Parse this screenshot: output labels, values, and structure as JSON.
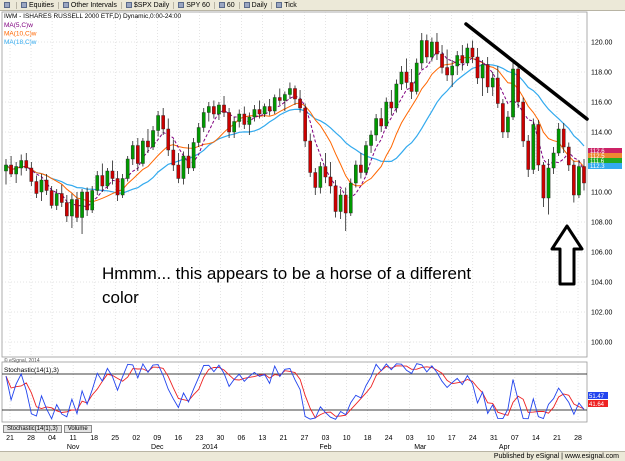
{
  "toolbar": {
    "items": [
      {
        "label": "",
        "icon": "grid-icon"
      },
      {
        "label": "Equities",
        "icon": "dropdown-icon"
      },
      {
        "label": "Other Intervals",
        "icon": "dropdown-icon"
      },
      {
        "label": "$SPX Daily",
        "icon": "chart-icon"
      },
      {
        "label": "SPY 60",
        "icon": "chart-icon"
      },
      {
        "label": "60",
        "icon": "chart-icon"
      },
      {
        "label": "Daily",
        "icon": "chart-icon"
      },
      {
        "label": "Tick",
        "icon": "chart-icon"
      }
    ]
  },
  "header": {
    "title": "IWM - ISHARES RUSSELL 2000 ETF,D) Dynamic,0:00-24:00",
    "ma_labels": [
      "MA(5,C)w",
      "MA(10,C)w",
      "MA(18,C)w"
    ]
  },
  "annotation": {
    "line1": "Hmmm... this appears to be a horse of a different",
    "line2": "color"
  },
  "stochastic_label": "Stochastic(14(1),3)",
  "tabs": [
    "Stochastic(14(1),3)",
    "Volume"
  ],
  "footer": "Published by eSignal | www.esignal.com",
  "copyright": "© eSignal, 2014",
  "colors": {
    "up": "#009900",
    "down": "#cc0000",
    "ma5": "#800080",
    "ma10": "#ff6600",
    "ma18": "#33aaee",
    "stoch_k": "#2244ee",
    "stoch_d": "#ee2222",
    "grid": "#c8c8c8",
    "price_labels": [
      "#cc2266",
      "#ee8833",
      "#22aa22",
      "#33aaee"
    ],
    "stoch_labels": [
      "#2244ee",
      "#ee2222"
    ]
  },
  "chart_data": {
    "type": "candlestick",
    "title": "IWM - ISHARES RUSSELL 2000 ETF,D) Dynamic,0:00-24:00",
    "ylim": [
      99,
      122
    ],
    "y_ticks": [
      "120.00",
      "118.00",
      "116.00",
      "114.00",
      "112.00",
      "110.00",
      "108.00",
      "106.00",
      "104.00",
      "102.00",
      "100.00"
    ],
    "current_price_labels": [
      "112.6",
      "112.5",
      "111.6",
      "112.3"
    ],
    "x_tick_labels": [
      "21",
      "28",
      "04",
      "11",
      "18",
      "25",
      "02",
      "09",
      "16",
      "23",
      "30",
      "06",
      "13",
      "21",
      "27",
      "03",
      "10",
      "18",
      "24",
      "03",
      "10",
      "17",
      "24",
      "31",
      "07",
      "14",
      "21",
      "28"
    ],
    "month_labels": [
      "Nov",
      "Dec",
      "2014",
      "Feb",
      "Mar",
      "Apr"
    ],
    "grid": true,
    "candles": [
      {
        "o": 111.4,
        "h": 112.2,
        "l": 110.5,
        "c": 111.8
      },
      {
        "o": 111.8,
        "h": 112.4,
        "l": 111.0,
        "c": 111.2
      },
      {
        "o": 111.2,
        "h": 112.0,
        "l": 110.6,
        "c": 111.7
      },
      {
        "o": 111.6,
        "h": 112.5,
        "l": 111.1,
        "c": 112.1
      },
      {
        "o": 112.1,
        "h": 112.6,
        "l": 111.4,
        "c": 111.6
      },
      {
        "o": 111.6,
        "h": 112.0,
        "l": 110.4,
        "c": 110.7
      },
      {
        "o": 110.7,
        "h": 111.1,
        "l": 109.6,
        "c": 109.9
      },
      {
        "o": 110.0,
        "h": 111.2,
        "l": 109.4,
        "c": 110.8
      },
      {
        "o": 110.8,
        "h": 111.2,
        "l": 109.8,
        "c": 110.1
      },
      {
        "o": 110.1,
        "h": 110.4,
        "l": 108.9,
        "c": 109.1
      },
      {
        "o": 109.1,
        "h": 110.2,
        "l": 108.8,
        "c": 109.9
      },
      {
        "o": 109.9,
        "h": 110.5,
        "l": 109.0,
        "c": 109.3
      },
      {
        "o": 109.3,
        "h": 109.8,
        "l": 108.0,
        "c": 108.4
      },
      {
        "o": 108.4,
        "h": 109.9,
        "l": 107.6,
        "c": 109.5
      },
      {
        "o": 109.5,
        "h": 110.0,
        "l": 108.0,
        "c": 108.3
      },
      {
        "o": 108.3,
        "h": 110.2,
        "l": 107.2,
        "c": 110.0
      },
      {
        "o": 110.0,
        "h": 110.3,
        "l": 108.4,
        "c": 108.8
      },
      {
        "o": 108.8,
        "h": 110.4,
        "l": 108.6,
        "c": 110.1
      },
      {
        "o": 110.1,
        "h": 111.4,
        "l": 109.8,
        "c": 111.1
      },
      {
        "o": 111.1,
        "h": 111.9,
        "l": 110.0,
        "c": 110.4
      },
      {
        "o": 110.4,
        "h": 111.6,
        "l": 110.2,
        "c": 111.4
      },
      {
        "o": 111.4,
        "h": 112.1,
        "l": 110.5,
        "c": 110.9
      },
      {
        "o": 110.9,
        "h": 111.4,
        "l": 109.4,
        "c": 109.8
      },
      {
        "o": 109.8,
        "h": 111.2,
        "l": 109.6,
        "c": 110.9
      },
      {
        "o": 110.9,
        "h": 112.4,
        "l": 110.7,
        "c": 112.2
      },
      {
        "o": 112.2,
        "h": 113.4,
        "l": 111.8,
        "c": 113.1
      },
      {
        "o": 113.1,
        "h": 113.6,
        "l": 111.4,
        "c": 111.9
      },
      {
        "o": 111.9,
        "h": 113.6,
        "l": 111.7,
        "c": 113.4
      },
      {
        "o": 113.4,
        "h": 114.2,
        "l": 112.6,
        "c": 113.0
      },
      {
        "o": 113.0,
        "h": 114.4,
        "l": 112.8,
        "c": 114.1
      },
      {
        "o": 114.1,
        "h": 115.4,
        "l": 113.7,
        "c": 115.1
      },
      {
        "o": 115.1,
        "h": 115.6,
        "l": 113.8,
        "c": 114.2
      },
      {
        "o": 114.2,
        "h": 114.9,
        "l": 112.4,
        "c": 112.8
      },
      {
        "o": 112.8,
        "h": 113.5,
        "l": 111.4,
        "c": 111.8
      },
      {
        "o": 111.8,
        "h": 112.6,
        "l": 110.6,
        "c": 110.9
      },
      {
        "o": 110.9,
        "h": 112.7,
        "l": 110.5,
        "c": 112.4
      },
      {
        "o": 112.4,
        "h": 113.2,
        "l": 111.2,
        "c": 111.6
      },
      {
        "o": 111.6,
        "h": 113.6,
        "l": 111.4,
        "c": 113.3
      },
      {
        "o": 113.3,
        "h": 114.6,
        "l": 113.0,
        "c": 114.3
      },
      {
        "o": 114.3,
        "h": 115.6,
        "l": 114.0,
        "c": 115.3
      },
      {
        "o": 115.3,
        "h": 116.0,
        "l": 114.7,
        "c": 115.7
      },
      {
        "o": 115.7,
        "h": 116.1,
        "l": 114.9,
        "c": 115.2
      },
      {
        "o": 115.2,
        "h": 116.0,
        "l": 114.8,
        "c": 115.8
      },
      {
        "o": 115.8,
        "h": 116.4,
        "l": 115.0,
        "c": 115.3
      },
      {
        "o": 115.3,
        "h": 115.6,
        "l": 113.6,
        "c": 114.0
      },
      {
        "o": 114.0,
        "h": 115.0,
        "l": 113.6,
        "c": 114.7
      },
      {
        "o": 114.7,
        "h": 115.5,
        "l": 114.3,
        "c": 115.2
      },
      {
        "o": 115.2,
        "h": 115.7,
        "l": 114.2,
        "c": 114.5
      },
      {
        "o": 114.5,
        "h": 115.3,
        "l": 113.8,
        "c": 115.0
      },
      {
        "o": 115.0,
        "h": 115.8,
        "l": 114.7,
        "c": 115.5
      },
      {
        "o": 115.5,
        "h": 116.1,
        "l": 114.9,
        "c": 115.2
      },
      {
        "o": 115.2,
        "h": 115.9,
        "l": 115.0,
        "c": 115.7
      },
      {
        "o": 115.7,
        "h": 116.2,
        "l": 115.1,
        "c": 115.4
      },
      {
        "o": 115.4,
        "h": 116.5,
        "l": 115.2,
        "c": 116.3
      },
      {
        "o": 116.3,
        "h": 116.9,
        "l": 115.8,
        "c": 116.1
      },
      {
        "o": 116.1,
        "h": 116.7,
        "l": 115.4,
        "c": 116.5
      },
      {
        "o": 116.5,
        "h": 117.3,
        "l": 116.2,
        "c": 116.9
      },
      {
        "o": 116.9,
        "h": 117.1,
        "l": 115.8,
        "c": 116.2
      },
      {
        "o": 116.2,
        "h": 116.8,
        "l": 115.3,
        "c": 115.6
      },
      {
        "o": 115.6,
        "h": 115.9,
        "l": 113.0,
        "c": 113.4
      },
      {
        "o": 113.4,
        "h": 113.9,
        "l": 111.0,
        "c": 111.3
      },
      {
        "o": 111.3,
        "h": 111.6,
        "l": 109.8,
        "c": 110.3
      },
      {
        "o": 110.3,
        "h": 112.0,
        "l": 109.9,
        "c": 111.7
      },
      {
        "o": 111.7,
        "h": 112.6,
        "l": 110.6,
        "c": 111.0
      },
      {
        "o": 111.0,
        "h": 112.0,
        "l": 109.9,
        "c": 110.4
      },
      {
        "o": 110.4,
        "h": 110.8,
        "l": 108.3,
        "c": 108.7
      },
      {
        "o": 108.7,
        "h": 110.2,
        "l": 108.2,
        "c": 109.8
      },
      {
        "o": 109.8,
        "h": 110.3,
        "l": 107.4,
        "c": 108.6
      },
      {
        "o": 108.6,
        "h": 110.9,
        "l": 108.4,
        "c": 110.6
      },
      {
        "o": 110.6,
        "h": 112.1,
        "l": 110.3,
        "c": 111.8
      },
      {
        "o": 111.8,
        "h": 112.6,
        "l": 110.9,
        "c": 111.3
      },
      {
        "o": 111.3,
        "h": 113.4,
        "l": 111.1,
        "c": 113.1
      },
      {
        "o": 113.1,
        "h": 114.1,
        "l": 112.6,
        "c": 113.8
      },
      {
        "o": 113.8,
        "h": 115.2,
        "l": 113.4,
        "c": 114.9
      },
      {
        "o": 114.9,
        "h": 115.6,
        "l": 114.0,
        "c": 114.4
      },
      {
        "o": 114.4,
        "h": 116.3,
        "l": 114.2,
        "c": 116.0
      },
      {
        "o": 116.0,
        "h": 116.8,
        "l": 115.1,
        "c": 115.6
      },
      {
        "o": 115.6,
        "h": 117.5,
        "l": 115.3,
        "c": 117.2
      },
      {
        "o": 117.2,
        "h": 118.4,
        "l": 116.8,
        "c": 118.0
      },
      {
        "o": 118.0,
        "h": 118.9,
        "l": 116.9,
        "c": 117.3
      },
      {
        "o": 117.3,
        "h": 118.2,
        "l": 116.2,
        "c": 116.7
      },
      {
        "o": 116.7,
        "h": 118.9,
        "l": 116.5,
        "c": 118.6
      },
      {
        "o": 118.6,
        "h": 120.6,
        "l": 118.2,
        "c": 120.1
      },
      {
        "o": 120.1,
        "h": 120.5,
        "l": 118.6,
        "c": 119.0
      },
      {
        "o": 119.0,
        "h": 120.3,
        "l": 118.7,
        "c": 120.0
      },
      {
        "o": 120.0,
        "h": 120.6,
        "l": 118.8,
        "c": 119.2
      },
      {
        "o": 119.2,
        "h": 119.8,
        "l": 117.9,
        "c": 118.3
      },
      {
        "o": 118.3,
        "h": 119.5,
        "l": 117.4,
        "c": 117.8
      },
      {
        "o": 117.8,
        "h": 118.8,
        "l": 117.0,
        "c": 118.4
      },
      {
        "o": 118.4,
        "h": 119.4,
        "l": 117.8,
        "c": 119.1
      },
      {
        "o": 119.1,
        "h": 119.8,
        "l": 118.1,
        "c": 118.6
      },
      {
        "o": 118.6,
        "h": 119.9,
        "l": 118.4,
        "c": 119.6
      },
      {
        "o": 119.6,
        "h": 120.1,
        "l": 118.6,
        "c": 119.0
      },
      {
        "o": 119.0,
        "h": 119.6,
        "l": 117.2,
        "c": 117.6
      },
      {
        "o": 117.6,
        "h": 118.8,
        "l": 116.4,
        "c": 118.5
      },
      {
        "o": 118.5,
        "h": 119.0,
        "l": 116.6,
        "c": 117.0
      },
      {
        "o": 117.0,
        "h": 118.0,
        "l": 116.4,
        "c": 117.6
      },
      {
        "o": 117.6,
        "h": 118.4,
        "l": 115.6,
        "c": 115.9
      },
      {
        "o": 115.9,
        "h": 116.2,
        "l": 113.6,
        "c": 114.0
      },
      {
        "o": 114.0,
        "h": 115.4,
        "l": 113.6,
        "c": 115.0
      },
      {
        "o": 115.0,
        "h": 118.6,
        "l": 114.8,
        "c": 118.2
      },
      {
        "o": 118.2,
        "h": 118.5,
        "l": 115.6,
        "c": 116.0
      },
      {
        "o": 116.0,
        "h": 116.3,
        "l": 113.0,
        "c": 113.4
      },
      {
        "o": 113.4,
        "h": 113.8,
        "l": 111.0,
        "c": 111.5
      },
      {
        "o": 111.5,
        "h": 114.9,
        "l": 111.2,
        "c": 114.5
      },
      {
        "o": 114.5,
        "h": 114.8,
        "l": 111.4,
        "c": 111.8
      },
      {
        "o": 111.8,
        "h": 112.0,
        "l": 109.0,
        "c": 109.6
      },
      {
        "o": 109.6,
        "h": 112.2,
        "l": 108.5,
        "c": 111.6
      },
      {
        "o": 111.6,
        "h": 113.0,
        "l": 111.2,
        "c": 112.6
      },
      {
        "o": 112.6,
        "h": 114.6,
        "l": 112.4,
        "c": 114.2
      },
      {
        "o": 114.2,
        "h": 114.6,
        "l": 112.6,
        "c": 113.0
      },
      {
        "o": 113.0,
        "h": 113.3,
        "l": 111.4,
        "c": 111.8
      },
      {
        "o": 111.8,
        "h": 112.1,
        "l": 109.3,
        "c": 109.8
      },
      {
        "o": 109.8,
        "h": 112.1,
        "l": 109.6,
        "c": 111.7
      },
      {
        "o": 111.7,
        "h": 112.2,
        "l": 110.1,
        "c": 110.6
      }
    ]
  },
  "stochastic_data": {
    "ylim": [
      0,
      100
    ],
    "levels": [
      80,
      20
    ],
    "current_labels": [
      "51.47",
      "41.64"
    ]
  }
}
